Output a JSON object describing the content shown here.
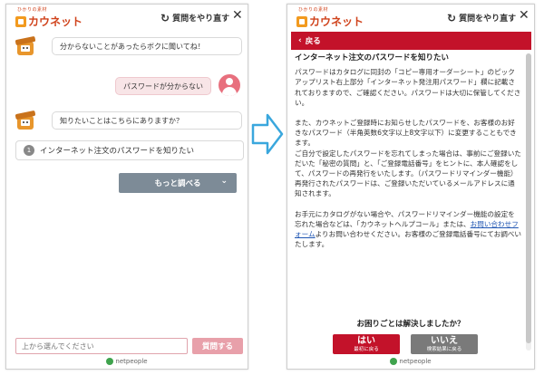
{
  "logo": {
    "sub": "ひかりの素材",
    "main": "カウネット"
  },
  "header": {
    "restart_label": "質問をやり直す",
    "close_symbol": "✕"
  },
  "left": {
    "bot_message_1": "分からないことがあったらボクに聞いてね！",
    "user_message": "パスワードが分からない",
    "bot_message_2": "知りたいことはこちらにありますか？",
    "option": {
      "number": "1",
      "label": "インターネット注文のパスワードを知りたい"
    },
    "more_button": "もっと調べる",
    "input_placeholder": "上から選んでください",
    "send_button": "質問する",
    "powered_by": "netpeople"
  },
  "right": {
    "back_label": "戻る",
    "title": "インターネット注文のパスワードを知りたい",
    "para1": "パスワードはカタログに同封の「コピー専用オーダーシート」のピックアップリスト右上部分「インターネット発注用パスワード」欄に記載されておりますので、ご確認ください。パスワードは大切に保管してください。",
    "para2": "また、カウネットご登録時にお知らせしたパスワードを、お客様のお好きなパスワード（半角英数6文字以上8文字以下）に変更することもできます。",
    "para3a": "ご自分で設定したパスワードを忘れてしまった場合は、事前にご登録いただいた「秘密の質問」と、「ご登録電話番号」をヒントに、本人確認をして、パスワードの再発行をいたします。（パスワードリマインダー機能）",
    "para3b": "再発行されたパスワードは、ご登録いただいているメールアドレスに通知されます。",
    "para4_before": "お手元にカタログがない場合や、パスワードリマインダー機能の設定を忘れた場合などは、「カウネットヘルプコール」または、",
    "para4_link": "お問い合わせフォーム",
    "para4_after": "よりお問い合わせください。お客様のご登録電話番号にてお調べいたします。",
    "solved_question": "お困りごとは解決しましたか？",
    "yes_main": "はい",
    "yes_sub": "最初に戻る",
    "no_main": "いいえ",
    "no_sub": "検索結果に戻る",
    "powered_by": "netpeople"
  },
  "colors": {
    "brand_red": "#c3122a",
    "logo_orange": "#f29a1f",
    "arrow_blue": "#3aa7dd",
    "user_bubble": "#f8e5e7"
  }
}
